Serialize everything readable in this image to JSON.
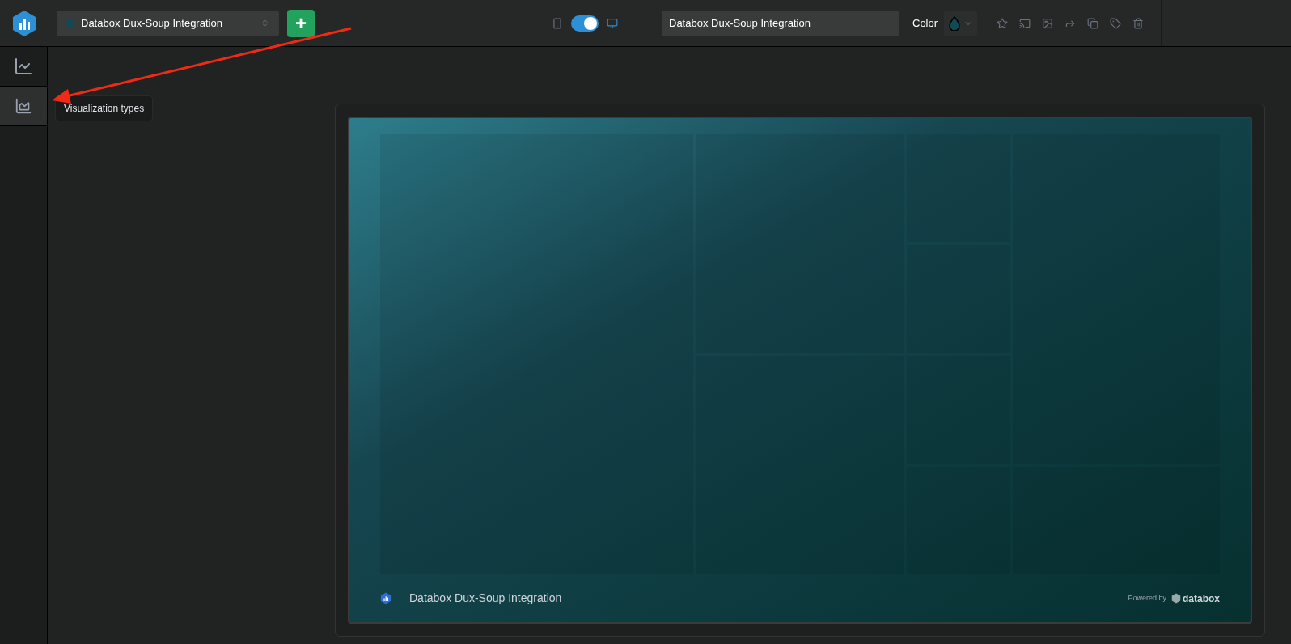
{
  "header": {
    "dashboard_select": {
      "value": "Databox Dux-Soup Integration"
    },
    "add_button": {
      "label": "+"
    },
    "device_toggle": {
      "on": true
    },
    "title_field": {
      "value": "Databox Dux-Soup Integration"
    },
    "color": {
      "label": "Color",
      "color": "#0f4a55"
    }
  },
  "sidebar": {
    "items": [
      {
        "kind": "charts",
        "selected": false
      },
      {
        "kind": "visualizations",
        "selected": true
      }
    ]
  },
  "tooltip": {
    "text": "Visualization types"
  },
  "board": {
    "title": "Databox Dux-Soup Integration",
    "powered_by": "Powered by",
    "brand": "databox"
  }
}
